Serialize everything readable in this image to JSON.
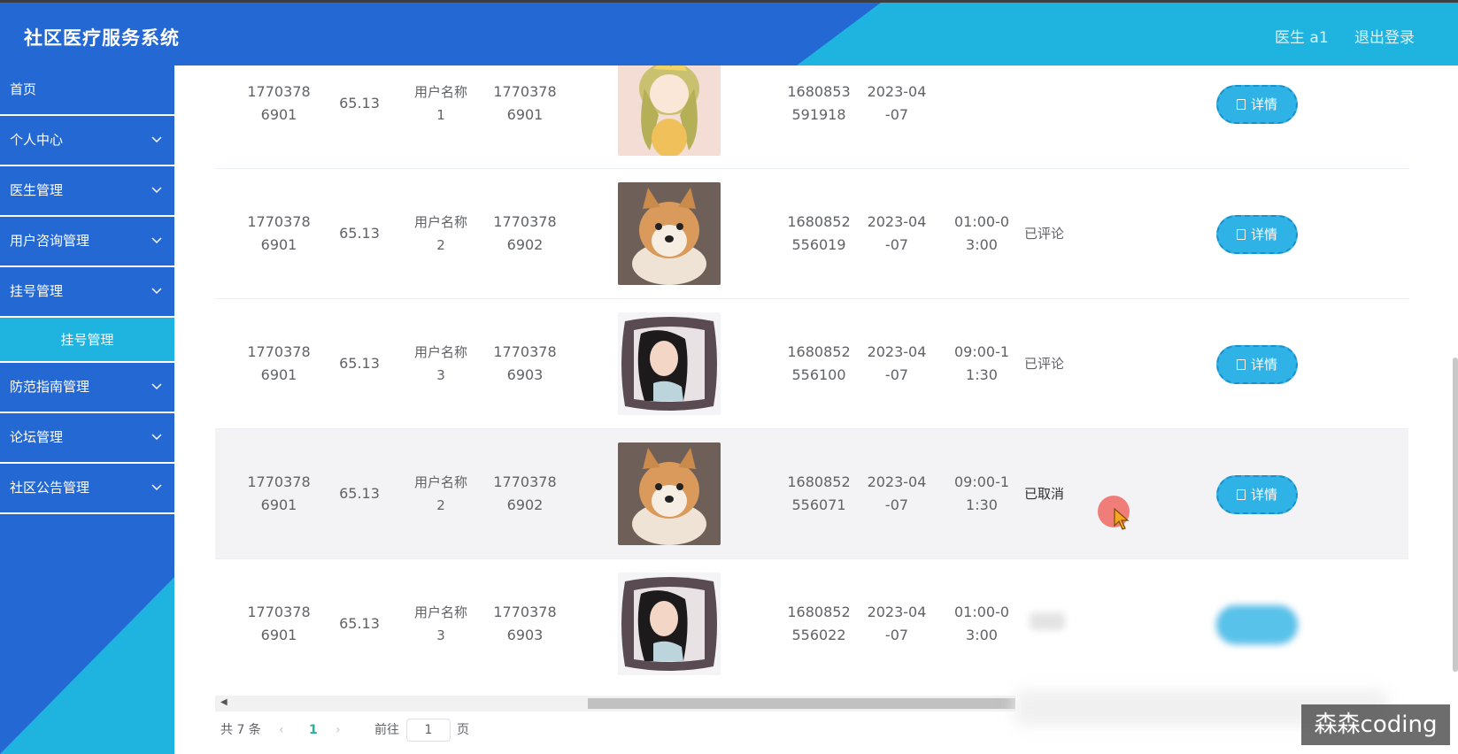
{
  "header": {
    "title": "社区医疗服务系统",
    "user": "医生 a1",
    "logout": "退出登录"
  },
  "sidebar": {
    "items": [
      {
        "label": "首页"
      },
      {
        "label": "个人中心"
      },
      {
        "label": "医生管理"
      },
      {
        "label": "用户咨询管理"
      },
      {
        "label": "挂号管理"
      },
      {
        "label": "挂号管理"
      },
      {
        "label": "防范指南管理"
      },
      {
        "label": "论坛管理"
      },
      {
        "label": "社区公告管理"
      }
    ]
  },
  "table": {
    "rows": [
      {
        "c1a": "1770378",
        "c1b": "6901",
        "c2": "65.13",
        "c3a": "用户名称",
        "c3b": "1",
        "c4a": "1770378",
        "c4b": "6901",
        "img": "anime-girl-image",
        "c6a": "1680853",
        "c6b": "591918",
        "c7a": "2023-04",
        "c7b": "-07",
        "c8a": "",
        "c8b": "",
        "c9": "",
        "btn": "详情"
      },
      {
        "c1a": "1770378",
        "c1b": "6901",
        "c2": "65.13",
        "c3a": "用户名称",
        "c3b": "2",
        "c4a": "1770378",
        "c4b": "6902",
        "img": "shiba-dog-image",
        "c6a": "1680852",
        "c6b": "556019",
        "c7a": "2023-04",
        "c7b": "-07",
        "c8a": "01:00-0",
        "c8b": "3:00",
        "c9": "已评论",
        "btn": "详情"
      },
      {
        "c1a": "1770378",
        "c1b": "6901",
        "c2": "65.13",
        "c3a": "用户名称",
        "c3b": "3",
        "c4a": "1770378",
        "c4b": "6903",
        "img": "woman-pillow-image",
        "c6a": "1680852",
        "c6b": "556100",
        "c7a": "2023-04",
        "c7b": "-07",
        "c8a": "09:00-1",
        "c8b": "1:30",
        "c9": "已评论",
        "btn": "详情"
      },
      {
        "c1a": "1770378",
        "c1b": "6901",
        "c2": "65.13",
        "c3a": "用户名称",
        "c3b": "2",
        "c4a": "1770378",
        "c4b": "6902",
        "img": "shiba-dog-image",
        "c6a": "1680852",
        "c6b": "556071",
        "c7a": "2023-04",
        "c7b": "-07",
        "c8a": "09:00-1",
        "c8b": "1:30",
        "c9": "已取消",
        "btn": "详情"
      },
      {
        "c1a": "1770378",
        "c1b": "6901",
        "c2": "65.13",
        "c3a": "用户名称",
        "c3b": "3",
        "c4a": "1770378",
        "c4b": "6903",
        "img": "woman-pillow-image",
        "c6a": "1680852",
        "c6b": "556022",
        "c7a": "2023-04",
        "c7b": "-07",
        "c8a": "01:00-0",
        "c8b": "3:00",
        "c9": "",
        "btn": ""
      }
    ]
  },
  "pagination": {
    "total": "共 7 条",
    "current": "1",
    "goto": "前往",
    "page_input": "1",
    "page_suffix": "页"
  },
  "watermark": "森森coding",
  "colors": {
    "header_blue": "#2468d4",
    "header_cyan": "#1fb3e0",
    "button": "#2fb3e6"
  }
}
